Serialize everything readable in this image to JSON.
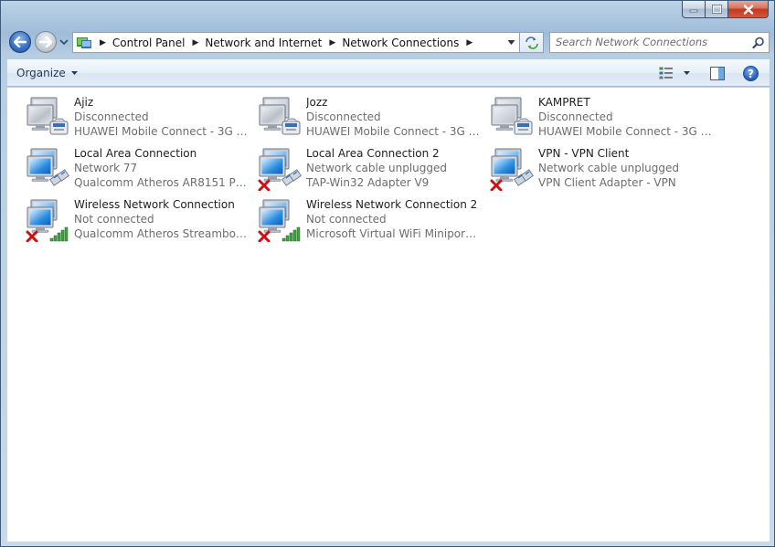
{
  "window": {
    "min_label": "",
    "max_label": "",
    "close_label": ""
  },
  "address": {
    "crumbs": [
      "Control Panel",
      "Network and Internet",
      "Network Connections"
    ]
  },
  "search": {
    "placeholder": "Search Network Connections"
  },
  "command_bar": {
    "organize_label": "Organize",
    "help_label": "?"
  },
  "connections": [
    {
      "name": "Ajiz",
      "status": "Disconnected",
      "device": "HUAWEI Mobile Connect - 3G M...",
      "type": "modem",
      "disabled": false
    },
    {
      "name": "Jozz",
      "status": "Disconnected",
      "device": "HUAWEI Mobile Connect - 3G M...",
      "type": "modem",
      "disabled": false
    },
    {
      "name": "KAMPRET",
      "status": "Disconnected",
      "device": "HUAWEI Mobile Connect - 3G M...",
      "type": "modem",
      "disabled": false
    },
    {
      "name": "Local Area Connection",
      "status": "Network  77",
      "device": "Qualcomm Atheros AR8151 PCI-E...",
      "type": "lan",
      "disabled": false
    },
    {
      "name": "Local Area Connection 2",
      "status": "Network cable unplugged",
      "device": "TAP-Win32 Adapter V9",
      "type": "lan",
      "disabled": true
    },
    {
      "name": "VPN - VPN Client",
      "status": "Network cable unplugged",
      "device": "VPN Client Adapter - VPN",
      "type": "lan",
      "disabled": true
    },
    {
      "name": "Wireless Network Connection",
      "status": "Not connected",
      "device": "Qualcomm Atheros Streamboost ...",
      "type": "wifi",
      "disabled": true
    },
    {
      "name": "Wireless Network Connection 2",
      "status": "Not connected",
      "device": "Microsoft Virtual WiFi Miniport A...",
      "type": "wifi",
      "disabled": true
    }
  ],
  "colors": {
    "accent": "#1e395b",
    "status_text": "#6d6d6d",
    "error_x": "#d01010"
  }
}
